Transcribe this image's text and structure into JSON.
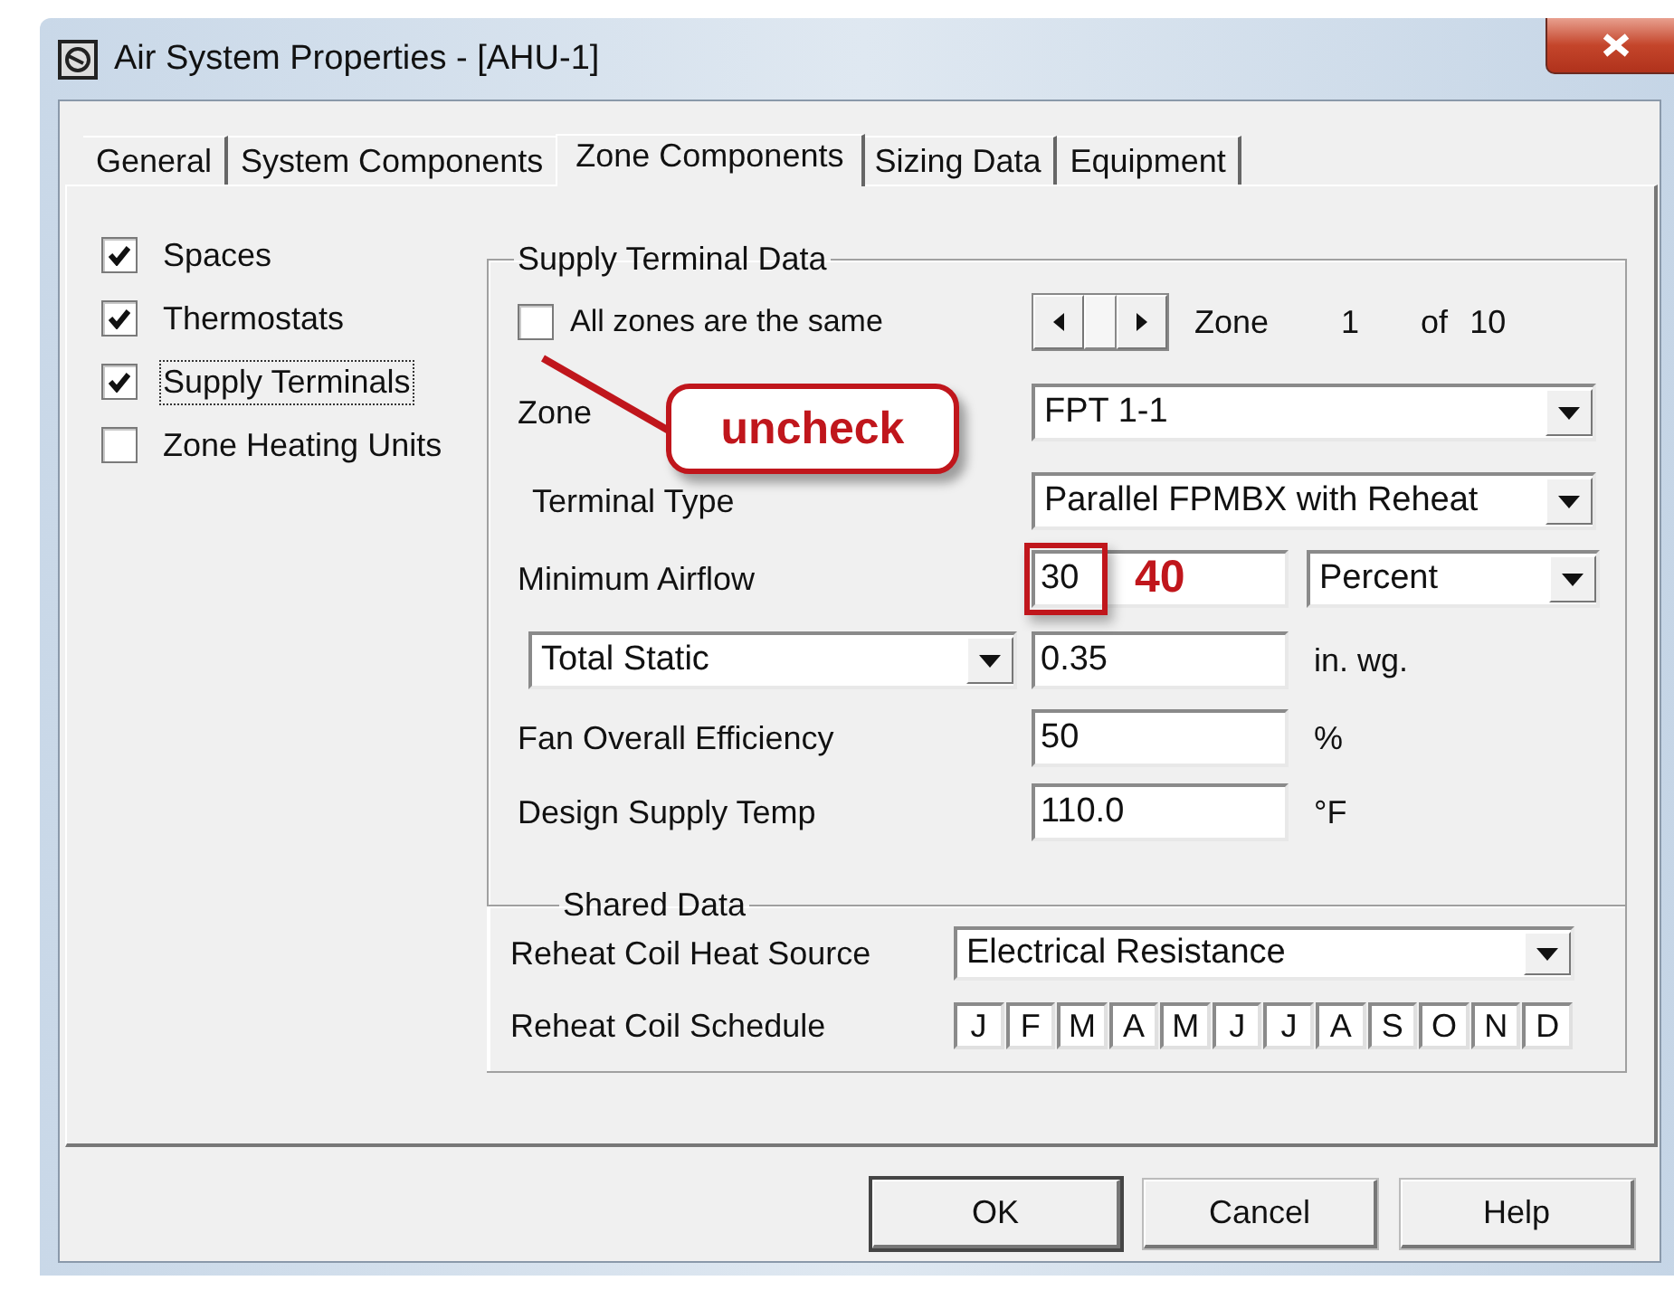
{
  "window": {
    "title": "Air System Properties - [AHU-1]"
  },
  "tabs": [
    {
      "label": "General",
      "selected": false
    },
    {
      "label": "System Components",
      "selected": false
    },
    {
      "label": "Zone Components",
      "selected": true
    },
    {
      "label": "Sizing Data",
      "selected": false
    },
    {
      "label": "Equipment",
      "selected": false
    }
  ],
  "components": [
    {
      "label": "Spaces",
      "checked": true
    },
    {
      "label": "Thermostats",
      "checked": true
    },
    {
      "label": "Supply Terminals",
      "checked": true
    },
    {
      "label": "Zone Heating Units",
      "checked": false
    }
  ],
  "supply_terminal_data": {
    "title": "Supply Terminal Data",
    "all_zones_same": {
      "label": "All zones are the same",
      "checked": false
    },
    "zone_navigator": {
      "label": "Zone",
      "current": "1",
      "of": "of",
      "total": "10"
    },
    "zone": {
      "label": "Zone",
      "value": "FPT 1-1"
    },
    "terminal_type": {
      "label": "Terminal Type",
      "value": "Parallel FPMBX with Reheat"
    },
    "minimum_airflow": {
      "label": "Minimum Airflow",
      "value": "30",
      "unit": "Percent"
    },
    "static": {
      "type": "Total Static",
      "value": "0.35",
      "unit": "in. wg."
    },
    "fan_efficiency": {
      "label": "Fan Overall Efficiency",
      "value": "50",
      "unit": "%"
    },
    "design_supply_temp": {
      "label": "Design Supply Temp",
      "value": "110.0",
      "unit": "°F"
    }
  },
  "shared_data": {
    "title": "Shared Data",
    "heat_source": {
      "label": "Reheat Coil Heat Source",
      "value": "Electrical Resistance"
    },
    "schedule": {
      "label": "Reheat Coil Schedule",
      "months": [
        "J",
        "F",
        "M",
        "A",
        "M",
        "J",
        "J",
        "A",
        "S",
        "O",
        "N",
        "D"
      ]
    }
  },
  "annotations": [
    {
      "kind": "callout",
      "text": "uncheck"
    },
    {
      "kind": "highlight",
      "text": "40"
    }
  ],
  "buttons": [
    {
      "label": "OK",
      "default": true
    },
    {
      "label": "Cancel",
      "default": false
    },
    {
      "label": "Help",
      "default": false
    }
  ]
}
